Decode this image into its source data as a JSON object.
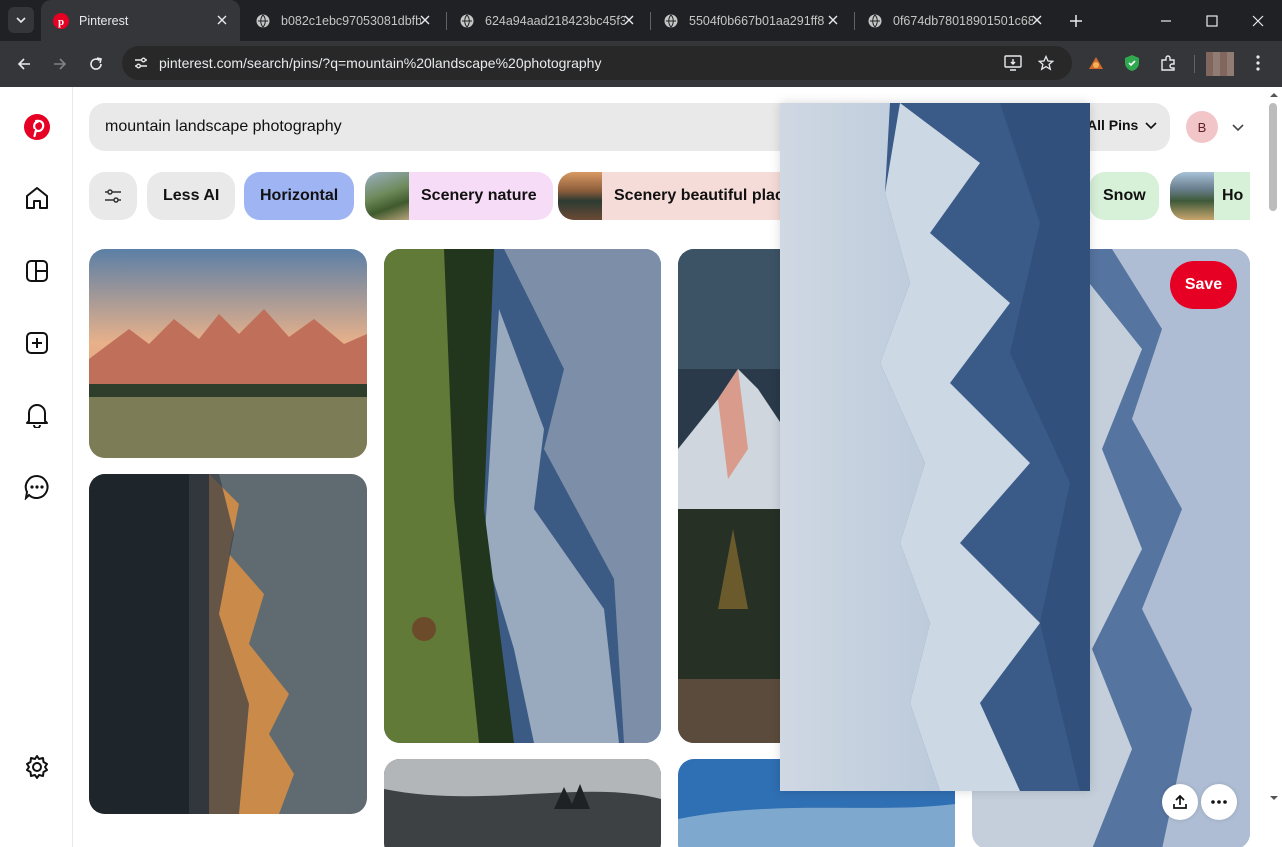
{
  "browser": {
    "tabs": [
      {
        "title": "Pinterest",
        "active": true
      },
      {
        "title": "b082c1ebc97053081dbfb",
        "active": false
      },
      {
        "title": "624a94aad218423bc45f3",
        "active": false
      },
      {
        "title": "5504f0b667b01aa291ff8",
        "active": false
      },
      {
        "title": "0f674db78018901501c68",
        "active": false
      }
    ],
    "url": "pinterest.com/search/pins/?q=mountain%20landscape%20photography"
  },
  "search": {
    "query": "mountain landscape photography",
    "filter_label": "All Pins"
  },
  "account": {
    "initial": "B"
  },
  "chips": [
    {
      "label": "Less AI",
      "bg": "#e9e9e9",
      "thumb": false
    },
    {
      "label": "Horizontal",
      "bg": "#9fb4f2",
      "thumb": false
    },
    {
      "label": "Scenery nature",
      "bg": "#f7dcf7",
      "thumb": true
    },
    {
      "label": "Scenery beautiful places",
      "bg": "#f5dcd8",
      "thumb": true
    },
    {
      "label": "Snow",
      "bg": "#d7f0d8",
      "thumb": false
    },
    {
      "label": "Ho",
      "bg": "#d7f0d8",
      "thumb": true
    }
  ],
  "pin_actions": {
    "save_label": "Save"
  },
  "colors": {
    "brand": "#e60023",
    "chrome_bg": "#202124",
    "toolbar_bg": "#35363a"
  }
}
